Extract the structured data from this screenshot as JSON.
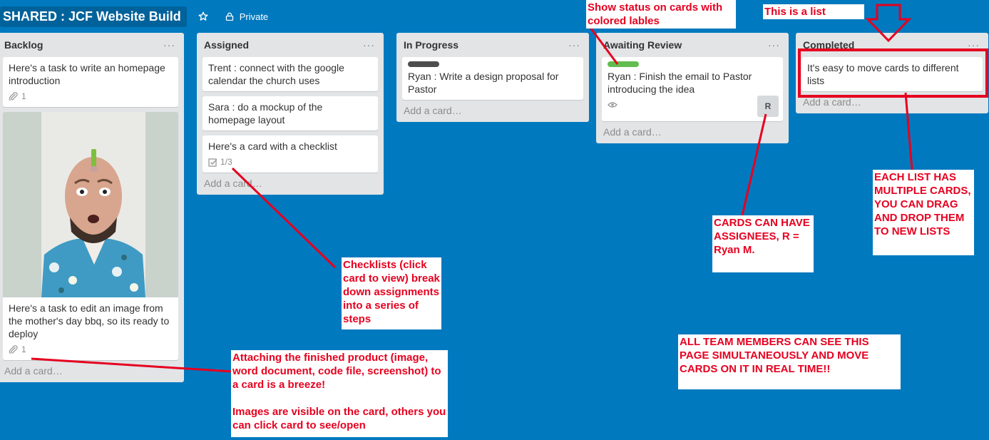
{
  "board": {
    "title": "SHARED : JCF Website Build",
    "visibility": "Private",
    "star_icon": "star-icon",
    "lock_icon": "lock-icon"
  },
  "colors": {
    "background": "#0079bf",
    "label_black": "#4d4d4d",
    "label_green": "#61bd4f",
    "annotation": "#e6001f"
  },
  "list_menu_glyph": "···",
  "lists": [
    {
      "name": "Backlog",
      "add_card": "Add a card…",
      "cards": [
        {
          "text": "Here's a task to write an homepage introduction",
          "attachments": "1"
        },
        {
          "text": "Here's a task to edit an image from the mother's day bbq, so its ready to deploy",
          "attachments": "1",
          "cover": "photo of man with pencil on head"
        }
      ]
    },
    {
      "name": "Assigned",
      "add_card": "Add a card…",
      "cards": [
        {
          "text": "Trent : connect with the google calendar the church uses"
        },
        {
          "text": "Sara : do a mockup of the homepage layout"
        },
        {
          "text": "Here's a card with a checklist",
          "checklist": "1/3"
        }
      ]
    },
    {
      "name": "In Progress",
      "add_card": "Add a card…",
      "cards": [
        {
          "text": "Ryan : Write a design proposal for Pastor",
          "label_color": "#4d4d4d"
        }
      ]
    },
    {
      "name": "Awaiting Review",
      "add_card": "Add a card…",
      "cards": [
        {
          "text": "Ryan : Finish the email to Pastor introducing the idea",
          "label_color": "#61bd4f",
          "watching": true,
          "member": "R"
        }
      ]
    },
    {
      "name": "Completed",
      "add_card": "Add a card…",
      "cards": [
        {
          "text": "It's easy to move cards to different lists"
        }
      ]
    }
  ],
  "annotations": {
    "labels": "Show status on cards with colored lables",
    "list": "This is a list",
    "checklists": "Checklists (click card to view) break down assignments into a series of steps",
    "assignees": "CARDS CAN HAVE ASSIGNEES, R = Ryan M.",
    "multiple": "EACH LIST HAS MULTIPLE CARDS, YOU CAN DRAG AND DROP THEM TO NEW LISTS",
    "realtime": "ALL TEAM MEMBERS CAN SEE THIS PAGE SIMULTANEOUSLY AND MOVE CARDS ON IT IN REAL TIME!!",
    "attach_1": "Attaching the finished product (image, word document, code file, screenshot) to a card is a breeze!",
    "attach_2": "Images are visible on the card, others you can click card to see/open"
  }
}
